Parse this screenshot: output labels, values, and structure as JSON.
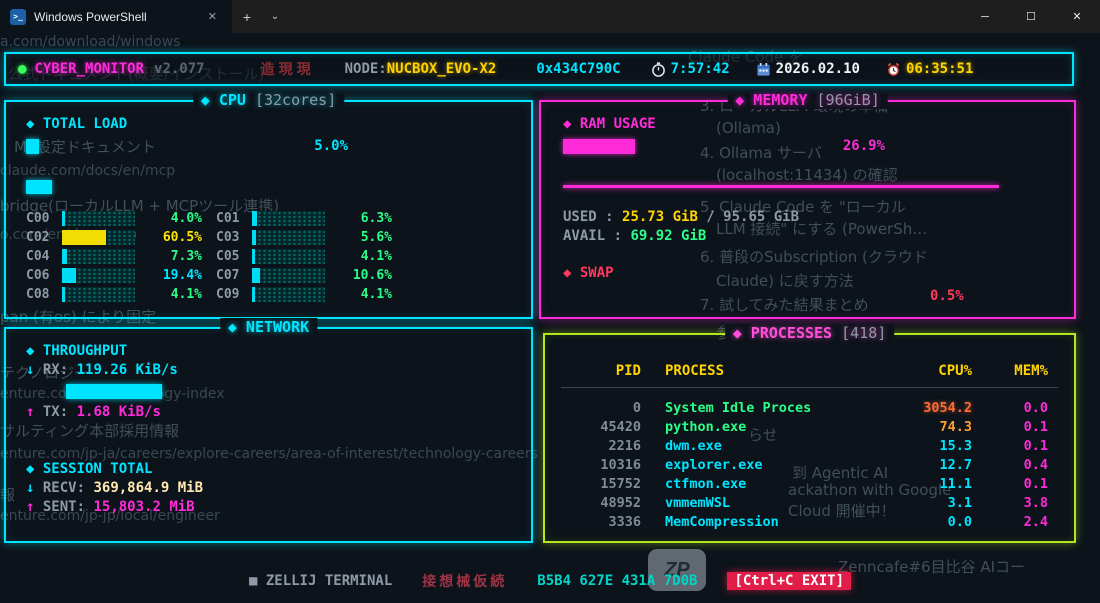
{
  "window": {
    "tab_title": "Windows PowerShell",
    "tab_close": "✕",
    "new_tab": "+",
    "tab_dropdown": "⌄",
    "minimize": "─",
    "maximize": "☐",
    "close": "✕",
    "ps_icon": ">_"
  },
  "header": {
    "dot": "●",
    "app": "CYBER_MONITOR",
    "version": "v2.077",
    "deco": "造現現",
    "node_label": "NODE:",
    "node": "NUCBOX_EVO-X2",
    "hex": "0x434C790C",
    "uptime_icon": "stopwatch-icon",
    "uptime": "7:57:42",
    "date_icon": "calendar-icon",
    "date": "2026.02.10",
    "time_icon": "alarm-clock-icon",
    "time": "06:35:51"
  },
  "cpu": {
    "title": "◆ CPU",
    "title_suffix": "[32cores]",
    "total_label": "◆ TOTAL LOAD",
    "total_pct": "5.0%",
    "cores": [
      {
        "id": "C00",
        "pct": "4.0%"
      },
      {
        "id": "C01",
        "pct": "6.3%"
      },
      {
        "id": "C02",
        "pct": "60.5%"
      },
      {
        "id": "C03",
        "pct": "5.6%"
      },
      {
        "id": "C04",
        "pct": "7.3%"
      },
      {
        "id": "C05",
        "pct": "4.1%"
      },
      {
        "id": "C06",
        "pct": "19.4%"
      },
      {
        "id": "C07",
        "pct": "10.6%"
      },
      {
        "id": "C08",
        "pct": "4.1%"
      },
      {
        "id": "C09",
        "pct": "4.1%"
      }
    ]
  },
  "memory": {
    "title": "◆ MEMORY",
    "title_suffix": "[96GiB]",
    "ram_label": "◆ RAM USAGE",
    "ram_pct": "26.9%",
    "used_label": "USED  :",
    "used_value": "25.73 GiB",
    "used_total": "/ 95.65 GiB",
    "avail_label": "AVAIL :",
    "avail_value": "69.92 GiB",
    "swap_label": "◆ SWAP",
    "swap_pct": "0.5%"
  },
  "network": {
    "title": "◆ NETWORK",
    "throughput_label": "◆ THROUGHPUT",
    "rx_arrow": "↓",
    "rx_label": "RX:",
    "rx_value": "119.26 KiB/s",
    "tx_arrow": "↑",
    "tx_label": "TX:",
    "tx_value": "1.68 KiB/s",
    "session_label": "◆ SESSION TOTAL",
    "recv_arrow": "↓",
    "recv_label": "RECV:",
    "recv_value": "369,864.9 MiB",
    "sent_arrow": "↑",
    "sent_label": "SENT:",
    "sent_value": "15,803.2 MiB"
  },
  "processes": {
    "title": "◆ PROCESSES",
    "title_suffix": "[418]",
    "columns": {
      "pid": "PID",
      "process": "PROCESS",
      "cpu": "CPU%",
      "mem": "MEM%"
    },
    "rows": [
      {
        "pid": "0",
        "name": "System Idle Proces",
        "cpu": "3054.2",
        "mem": "0.0"
      },
      {
        "pid": "45420",
        "name": "python.exe",
        "cpu": "74.3",
        "mem": "0.1"
      },
      {
        "pid": "2216",
        "name": "dwm.exe",
        "cpu": "15.3",
        "mem": "0.1"
      },
      {
        "pid": "10316",
        "name": "explorer.exe",
        "cpu": "12.7",
        "mem": "0.4"
      },
      {
        "pid": "15752",
        "name": "ctfmon.exe",
        "cpu": "11.1",
        "mem": "0.1"
      },
      {
        "pid": "48952",
        "name": "vmmemWSL",
        "cpu": "3.1",
        "mem": "3.8"
      },
      {
        "pid": "3336",
        "name": "MemCompression",
        "cpu": "0.0",
        "mem": "2.4"
      }
    ]
  },
  "footer": {
    "app": "■ ZELLIJ TERMINAL",
    "deco": "接想械仮続",
    "hex": "B5B4 627E 431A 7D0B",
    "exit": "[Ctrl+C EXIT]"
  },
  "ghost": {
    "watermark": "ZP",
    "items": [
      "a.com/download/windows",
      "公式ドキュメント(概要/インストール)",
      "Claude Code を",
      "Mi 設定ドキュメント",
      "claude.com/docs/en/mcp",
      "bridge(ローカルLLM + MCPツール連携)",
      "o.com/en/docs/mcp",
      "3. ローカルLLM 環境の準備",
      "(Ollama)",
      "4. Ollama サーバ",
      "(localhost:11434) の確認",
      "5. Claude Code を \"ローカル",
      "LLM 接続\" にする (PowerSh…",
      "6. 普段のSubscription (クラウド",
      "Claude) に戻す方法",
      "7. 試してみた結果まとめ",
      "参考リンク",
      "pan (有os) により固定",
      "テクノロジー",
      "enture.com/…/technology-index",
      "サルティング本部採用情報",
      "enture.com/jp-ja/careers/explore-careers/area-of-interest/technology-careers",
      "報",
      "enture.com/jp-jp/local/engineer",
      "らせ",
      "到 Agentic AI",
      "ackathon with Google",
      "Cloud 開催中！",
      "Zenncafe#6目比谷 AIコー"
    ]
  }
}
